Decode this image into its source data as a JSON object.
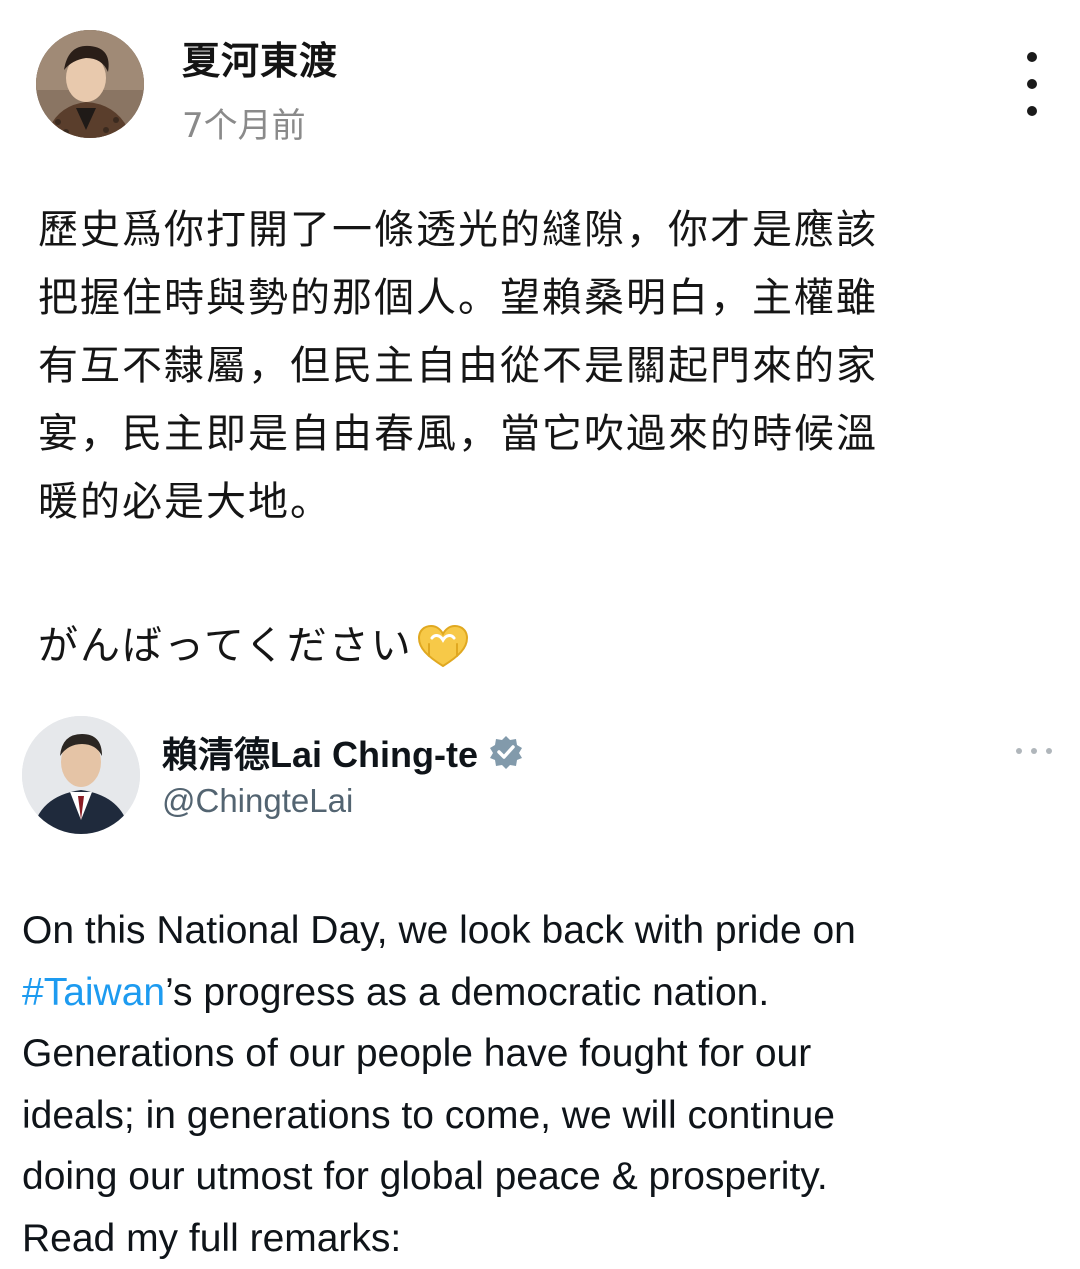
{
  "post": {
    "author_name": "夏河東渡",
    "time": "7个月前",
    "body_lines": [
      "歷史爲你打開了一條透光的縫隙，你才是應該",
      "把握住時與勢的那個人。望賴桑明白，主權雖",
      "有互不隸屬，但民主自由從不是關起門來的家",
      "宴，民主即是自由春風，當它吹過來的時候溫",
      "暖的必是大地。"
    ],
    "cheer_text": "がんばってください",
    "cheer_icon": "heart-hands-icon",
    "more_icon": "vertical-ellipsis-icon"
  },
  "tweet": {
    "name": "賴清德Lai Ching-te",
    "handle": "@ChingteLai",
    "verified_icon": "verified-badge-icon",
    "more_icon": "horizontal-ellipsis-icon",
    "text": {
      "line1": "On this National Day, we look back with pride on",
      "hashtag": "#Taiwan",
      "line2_rest": "’s progress as a democratic nation.",
      "line3": "Generations of our people have fought for our",
      "line4": "ideals; in generations to come, we will continue",
      "line5": "doing our utmost for global peace & prosperity.",
      "line6": "Read my full remarks:"
    }
  },
  "colors": {
    "hashtag": "#1d9bf0",
    "secondary_text": "#8a8a8a",
    "tweet_handle": "#536471",
    "verified_badge": "#829aab"
  }
}
